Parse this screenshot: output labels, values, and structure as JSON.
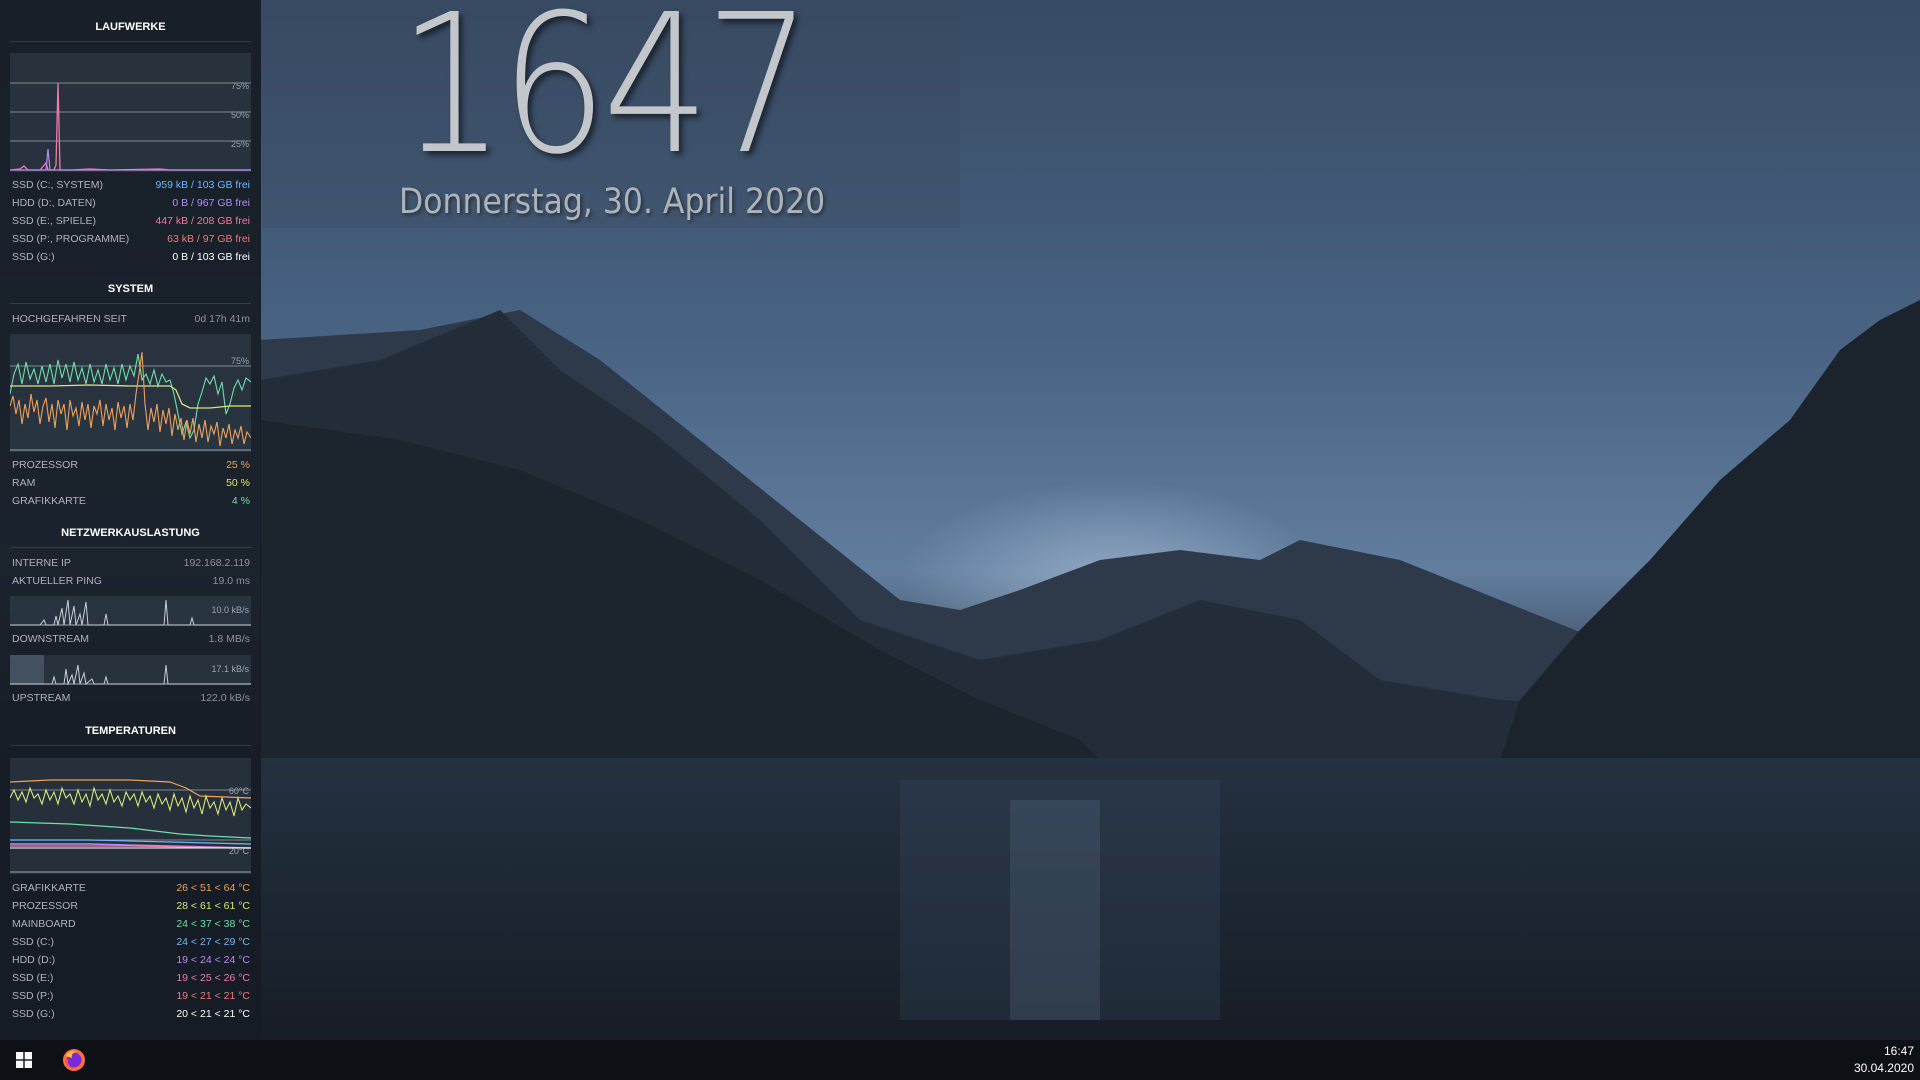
{
  "clock": {
    "time": "1647",
    "date": "Donnerstag, 30. April 2020"
  },
  "sidebar": {
    "drives": {
      "title": "LAUFWERKE",
      "graph_ticks": [
        "75%",
        "50%",
        "25%"
      ],
      "items": [
        {
          "label": "SSD (C:, SYSTEM)",
          "value": "959 kB / 103 GB frei",
          "color": "#6fb6ff"
        },
        {
          "label": "HDD (D:, DATEN)",
          "value": "0 B / 967 GB frei",
          "color": "#b78cf2"
        },
        {
          "label": "SSD (E:, SPIELE)",
          "value": "447 kB / 208 GB frei",
          "color": "#f07aa8"
        },
        {
          "label": "SSD (P:, PROGRAMME)",
          "value": "63 kB / 97 GB frei",
          "color": "#f07a78"
        },
        {
          "label": "SSD (G:)",
          "value": "0 B / 103 GB frei",
          "color": "#ffffff"
        }
      ]
    },
    "system": {
      "title": "SYSTEM",
      "uptime_label": "HOCHGEFAHREN SEIT",
      "uptime_value": "0d 17h 41m",
      "graph_ticks": [
        "75%"
      ],
      "items": [
        {
          "label": "PROZESSOR",
          "value": "25 %",
          "color": "#f0a05a"
        },
        {
          "label": "RAM",
          "value": "50 %",
          "color": "#d8e67a"
        },
        {
          "label": "GRAFIKKARTE",
          "value": "4 %",
          "color": "#6fe0a6"
        }
      ]
    },
    "network": {
      "title": "NETZWERKAUSLASTUNG",
      "ip_label": "INTERNE IP",
      "ip_value": "192.168.2.119",
      "ping_label": "AKTUELLER PING",
      "ping_value": "19.0 ms",
      "down_scale": "10.0 kB/s",
      "down_label": "DOWNSTREAM",
      "down_value": "1.8 MB/s",
      "up_scale": "17.1 kB/s",
      "up_label": "UPSTREAM",
      "up_value": "122.0 kB/s"
    },
    "temps": {
      "title": "TEMPERATUREN",
      "graph_ticks": [
        "60°C",
        "20°C"
      ],
      "items": [
        {
          "label": "GRAFIKKARTE",
          "value": "26 < 51 < 64 °C",
          "color": "#f0a05a"
        },
        {
          "label": "PROZESSOR",
          "value": "28 < 61 < 61 °C",
          "color": "#d8e67a"
        },
        {
          "label": "MAINBOARD",
          "value": "24 < 37 < 38 °C",
          "color": "#6fe0a6"
        },
        {
          "label": "SSD (C:)",
          "value": "24 < 27 < 29 °C",
          "color": "#6fb6ff"
        },
        {
          "label": "HDD (D:)",
          "value": "19 < 24 < 24 °C",
          "color": "#b78cf2"
        },
        {
          "label": "SSD (E:)",
          "value": "19 < 25 < 26 °C",
          "color": "#f07aa8"
        },
        {
          "label": "SSD (P:)",
          "value": "19 < 21 < 21 °C",
          "color": "#f07a78"
        },
        {
          "label": "SSD (G:)",
          "value": "20 < 21 < 21 °C",
          "color": "#ffffff"
        }
      ]
    }
  },
  "taskbar": {
    "start_icon": "windows-logo-icon",
    "pinned": [
      {
        "icon": "firefox-icon"
      }
    ],
    "tray_time": "16:47",
    "tray_date": "30.04.2020"
  }
}
